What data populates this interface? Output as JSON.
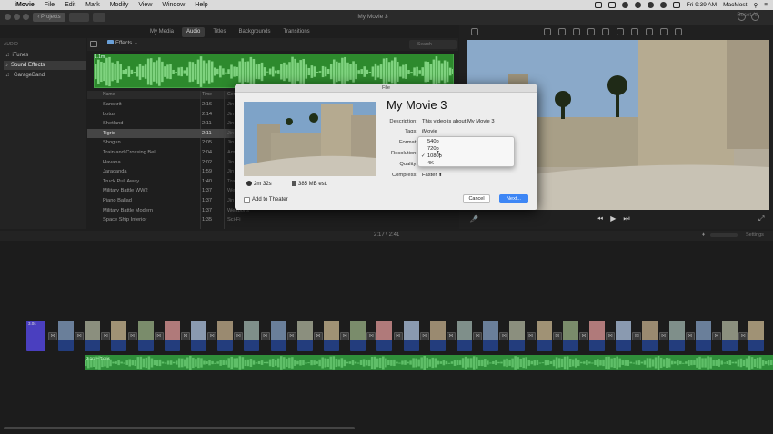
{
  "menubar": {
    "app": "iMovie",
    "items": [
      "File",
      "Edit",
      "Mark",
      "Modify",
      "View",
      "Window",
      "Help"
    ],
    "clock": "Fri 9:39 AM",
    "user": "MacMost"
  },
  "titlebar": {
    "projects_label": "Projects",
    "title": "My Movie 3",
    "reset_label": "Reset All"
  },
  "browser": {
    "tabs": [
      "My Media",
      "Audio",
      "Titles",
      "Backgrounds",
      "Transitions"
    ],
    "active_tab": "Audio",
    "effects_label": "Effects",
    "search_placeholder": "Search",
    "waveform_label": "1.1m"
  },
  "sidebar": {
    "heading": "AUDIO",
    "items": [
      {
        "label": "iTunes",
        "icon": "music-note-icon"
      },
      {
        "label": "Sound Effects",
        "icon": "speaker-icon"
      },
      {
        "label": "GarageBand",
        "icon": "guitar-icon"
      }
    ],
    "selected": "Sound Effects"
  },
  "list": {
    "columns": [
      "Name",
      "Time",
      "Genre"
    ],
    "rows": [
      {
        "name": "Sanskrit",
        "time": "2:16",
        "genre": "Jin"
      },
      {
        "name": "Lotus",
        "time": "2:14",
        "genre": "Jin"
      },
      {
        "name": "Shetland",
        "time": "2:11",
        "genre": "Jin"
      },
      {
        "name": "Tigris",
        "time": "2:11",
        "genre": "Jin"
      },
      {
        "name": "Shogun",
        "time": "2:05",
        "genre": "Jin"
      },
      {
        "name": "Train and Crossing Bell",
        "time": "2:04",
        "genre": "Am"
      },
      {
        "name": "Havana",
        "time": "2:02",
        "genre": "Jin"
      },
      {
        "name": "Jaracanda",
        "time": "1:59",
        "genre": "Jin"
      },
      {
        "name": "Truck Pull Away",
        "time": "1:40",
        "genre": "Tra"
      },
      {
        "name": "Military Battle WW2",
        "time": "1:37",
        "genre": "We"
      },
      {
        "name": "Piano Ballad",
        "time": "1:37",
        "genre": "Jin"
      },
      {
        "name": "Military Battle Modern",
        "time": "1:37",
        "genre": "Weapons"
      },
      {
        "name": "Space Ship Interior",
        "time": "1:35",
        "genre": "Sci-Fi"
      }
    ],
    "selected_index": 3
  },
  "dialog": {
    "window_title": "File",
    "movie_title": "My Movie 3",
    "description_label": "Description:",
    "description": "This video is about My Movie 3",
    "tags_label": "Tags:",
    "tags": "iMovie",
    "format_label": "Format:",
    "resolution_label": "Resolution:",
    "quality_label": "Quality:",
    "compress_label": "Compress:",
    "compress_value": "Faster",
    "resolution_options": [
      "540p",
      "720p",
      "1080p",
      "4K"
    ],
    "resolution_checked": "1080p",
    "duration": "2m 32s",
    "size_est": "385 MB est.",
    "theater_label": "Add to Theater",
    "cancel_label": "Cancel",
    "next_label": "Next..."
  },
  "timeline": {
    "timecode": "2:17 / 2:41",
    "settings_label": "Settings",
    "first_clip_label": "3.0s",
    "music_label": "2.1m – Tigris"
  }
}
